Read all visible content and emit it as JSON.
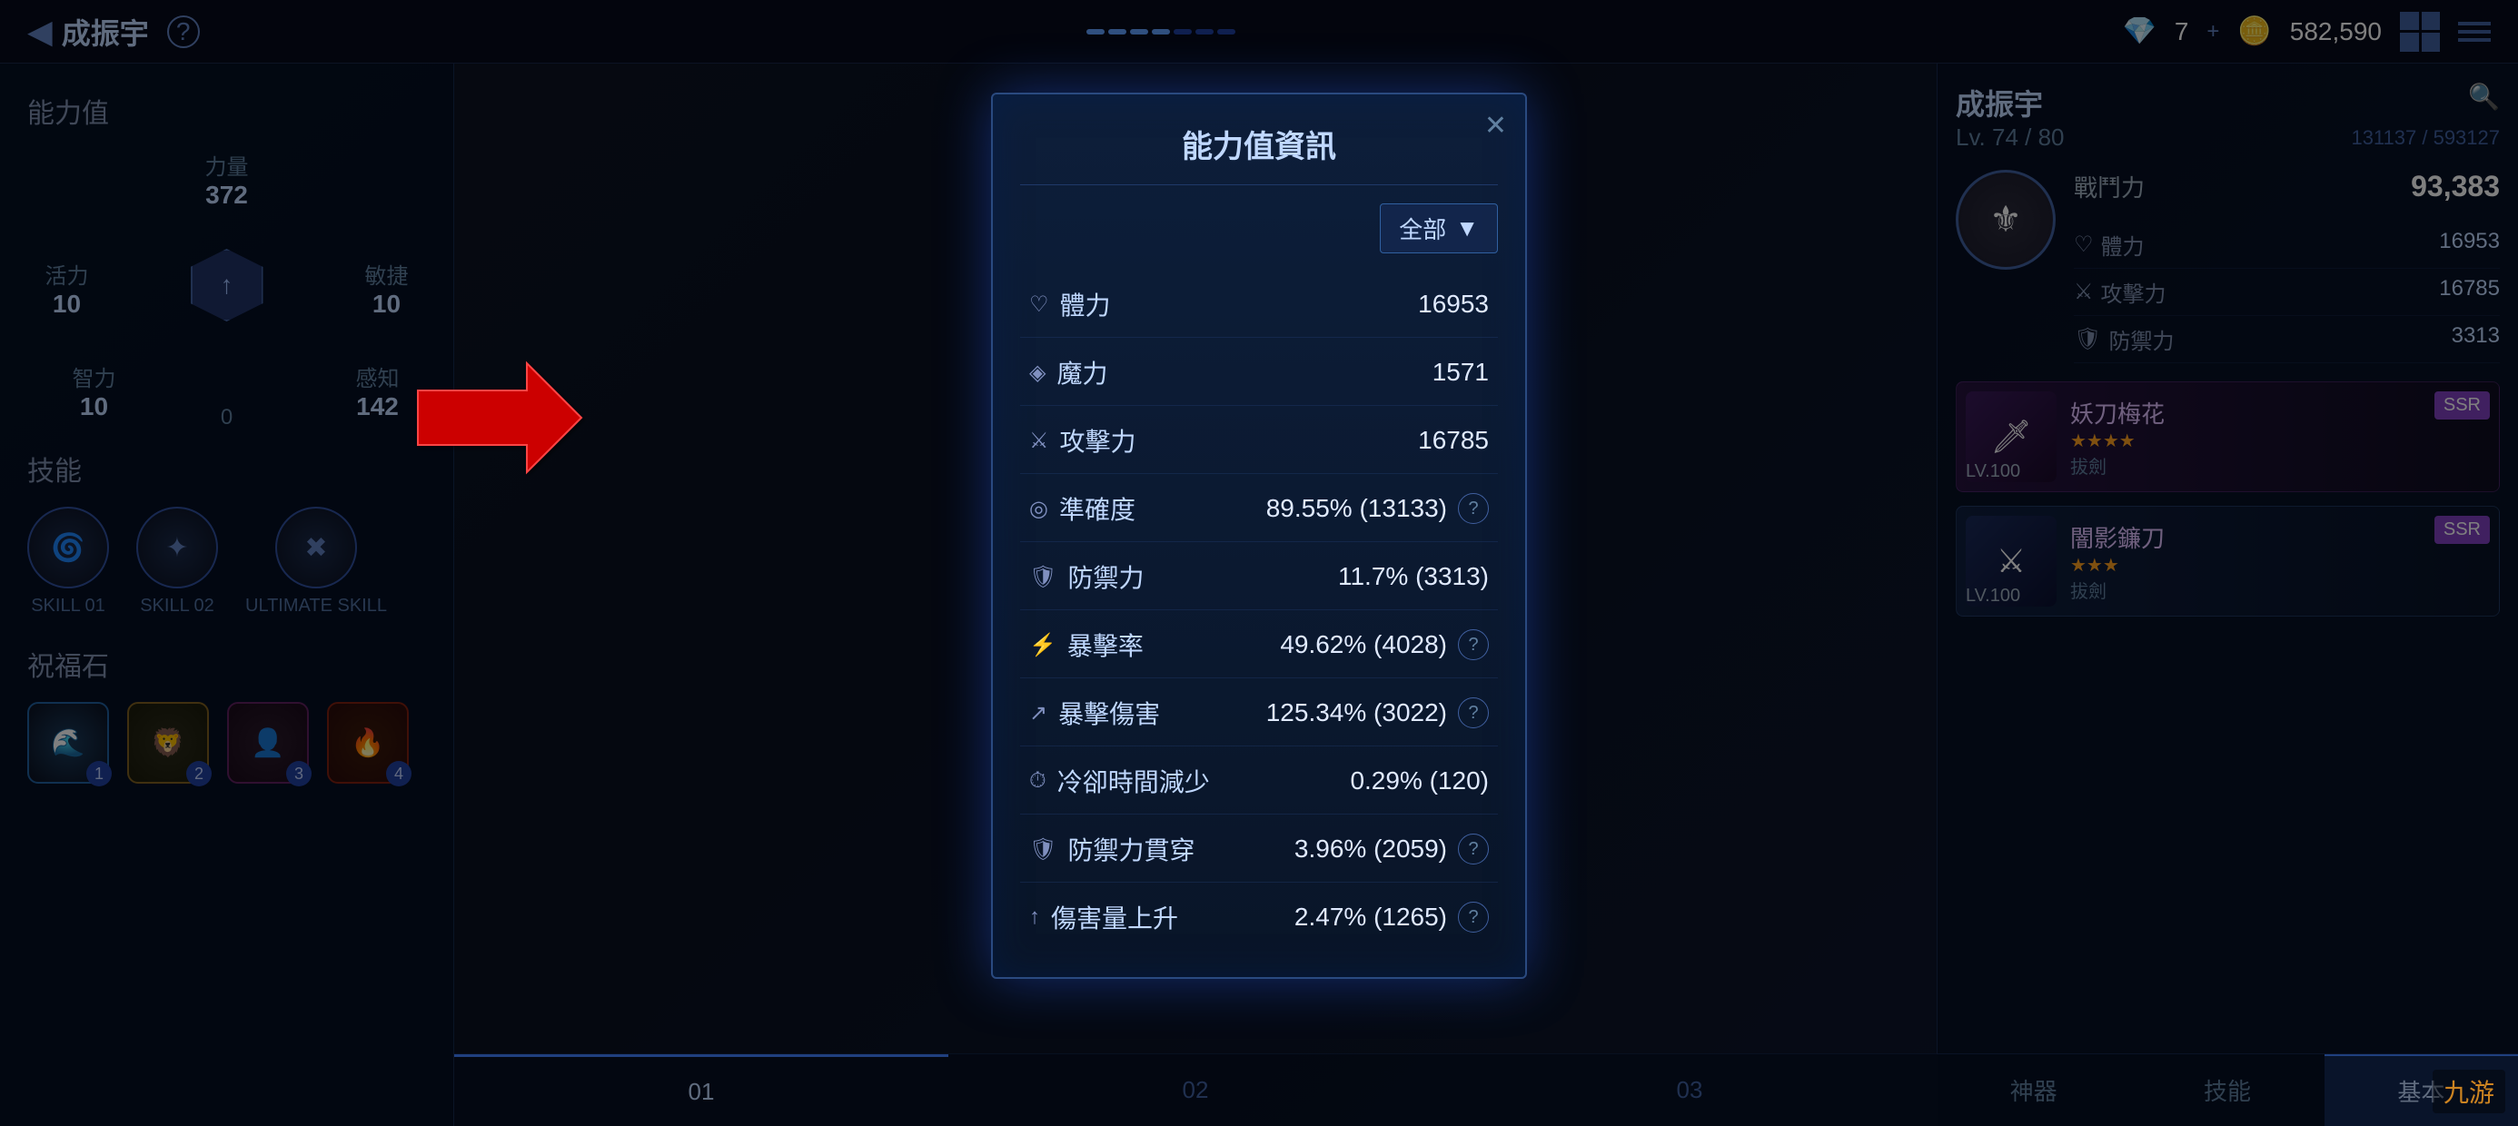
{
  "topbar": {
    "back_label": "◀",
    "char_name": "成振宇",
    "question_label": "?",
    "currency_gem": "7",
    "currency_plus": "+",
    "currency_coins": "582,590"
  },
  "progress": {
    "dots": [
      "lit",
      "lit",
      "lit",
      "lit",
      "lit",
      "lit",
      "lit"
    ]
  },
  "left_panel": {
    "stats_title": "能力值",
    "stat_power_label": "力量",
    "stat_power_val": "372",
    "stat_vitality_label": "活力",
    "stat_vitality_val": "10",
    "stat_agility_label": "敏捷",
    "stat_agility_val": "10",
    "stat_intelligence_label": "智力",
    "stat_intelligence_val": "10",
    "stat_perception_label": "感知",
    "stat_perception_val": "142",
    "stat_center_val": "0",
    "skills_title": "技能",
    "skill1_label": "SKILL 01",
    "skill2_label": "SKILL 02",
    "skill3_label": "ULTIMATE SKILL",
    "blessings_title": "祝福石",
    "blessing_nums": [
      "1",
      "2",
      "3",
      "4"
    ]
  },
  "modal": {
    "title": "能力值資訊",
    "close_label": "✕",
    "filter_label": "全部",
    "filter_arrow": "▼",
    "stats": [
      {
        "icon": "♡",
        "label": "體力",
        "value": "16953",
        "has_help": false
      },
      {
        "icon": "◈",
        "label": "魔力",
        "value": "1571",
        "has_help": false
      },
      {
        "icon": "⚔",
        "label": "攻擊力",
        "value": "16785",
        "has_help": false
      },
      {
        "icon": "◎",
        "label": "準確度",
        "value": "89.55% (13133)",
        "has_help": true
      },
      {
        "icon": "🛡",
        "label": "防禦力",
        "value": "11.7% (3313)",
        "has_help": false
      },
      {
        "icon": "⚡",
        "label": "暴擊率",
        "value": "49.62% (4028)",
        "has_help": true
      },
      {
        "icon": "↗",
        "label": "暴擊傷害",
        "value": "125.34% (3022)",
        "has_help": true
      },
      {
        "icon": "⏱",
        "label": "冷卻時間減少",
        "value": "0.29% (120)",
        "has_help": false
      },
      {
        "icon": "🛡",
        "label": "防禦力貫穿",
        "value": "3.96% (2059)",
        "has_help": true
      },
      {
        "icon": "↑",
        "label": "傷害量上升",
        "value": "2.47% (1265)",
        "has_help": true
      }
    ]
  },
  "right_panel": {
    "char_name": "成振宇",
    "search_icon": "🔍",
    "lv_current": "74",
    "lv_max": "80",
    "exp_current": "131137",
    "exp_max": "593127",
    "combat_power_label": "戰鬥力",
    "combat_power_val": "93,383",
    "stat_hp_label": "體力",
    "stat_hp_val": "16953",
    "stat_atk_label": "攻擊力",
    "stat_atk_val": "16785",
    "stat_def_label": "防禦力",
    "stat_def_val": "3313",
    "equip1_name": "妖刀梅花",
    "equip1_stars": "★★★★",
    "equip1_tag": "拔劍",
    "equip1_badge": "SSR",
    "equip1_lv": "100",
    "equip2_name": "闇影鐮刀",
    "equip2_stars": "★★★",
    "equip2_tag": "拔劍",
    "equip2_badge": "SSR",
    "equip2_lv": "100",
    "nav_items": [
      "神器",
      "技能",
      "基本"
    ]
  },
  "bottom_tabs": [
    "01",
    "02",
    "03"
  ],
  "logo": "九游"
}
